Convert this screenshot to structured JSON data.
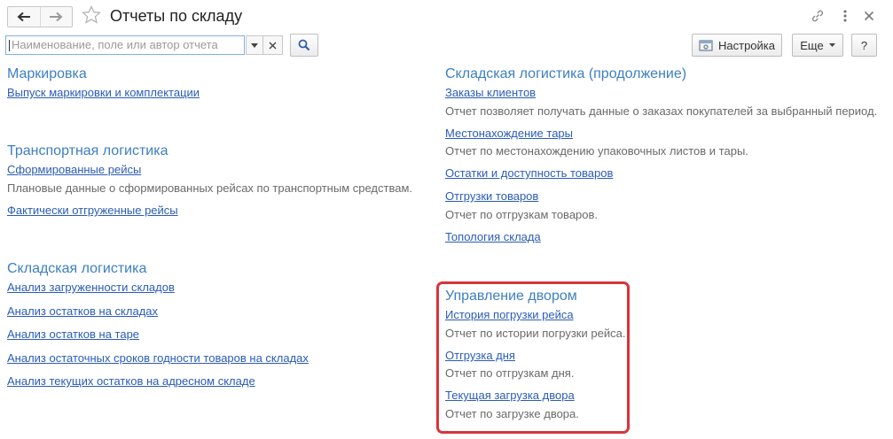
{
  "header": {
    "title": "Отчеты по складу"
  },
  "search": {
    "placeholder": "Наименование, поле или автор отчета"
  },
  "toolbar": {
    "settings_label": "Настройка",
    "more_label": "Еще",
    "help_label": "?"
  },
  "left": {
    "marking": {
      "title": "Маркировка",
      "items": [
        {
          "link": "Выпуск маркировки и комплектации"
        }
      ]
    },
    "transport": {
      "title": "Транспортная логистика",
      "items": [
        {
          "link": "Сформированные рейсы",
          "desc": "Плановые данные о сформированных рейсах по транспортным средствам."
        },
        {
          "link": "Фактически отгруженные рейсы"
        }
      ]
    },
    "warehouse": {
      "title": "Складская логистика",
      "items": [
        {
          "link": "Анализ загруженности складов"
        },
        {
          "link": "Анализ остатков на складах"
        },
        {
          "link": "Анализ остатков на таре"
        },
        {
          "link": "Анализ остаточных сроков годности товаров на складах"
        },
        {
          "link": "Анализ текущих остатков на адресном складе"
        }
      ]
    }
  },
  "right": {
    "warehouse_cont": {
      "title": "Складская логистика (продолжение)",
      "items": [
        {
          "link": "Заказы клиентов",
          "desc": "Отчет позволяет получать данные о заказах покупателей за выбранный период."
        },
        {
          "link": "Местонахождение тары",
          "desc": "Отчет по местонахождению упаковочных листов и тары."
        },
        {
          "link": "Остатки и доступность товаров"
        },
        {
          "link": "Отгрузки товаров",
          "desc": "Отчет по отгрузкам товаров."
        },
        {
          "link": "Топология склада"
        }
      ]
    },
    "yard": {
      "title": "Управление двором",
      "items": [
        {
          "link": "История погрузки рейса",
          "desc": "Отчет по истории погрузки рейса."
        },
        {
          "link": "Отгрузка дня",
          "desc": "Отчет по отгрузкам дня."
        },
        {
          "link": "Текущая загрузка двора",
          "desc": "Отчет по загрузке двора."
        }
      ]
    }
  },
  "colors": {
    "section_title": "#3d7fc1",
    "link": "#2a5cb8",
    "description": "#6a6a6a",
    "highlight_border": "#d8343a"
  }
}
